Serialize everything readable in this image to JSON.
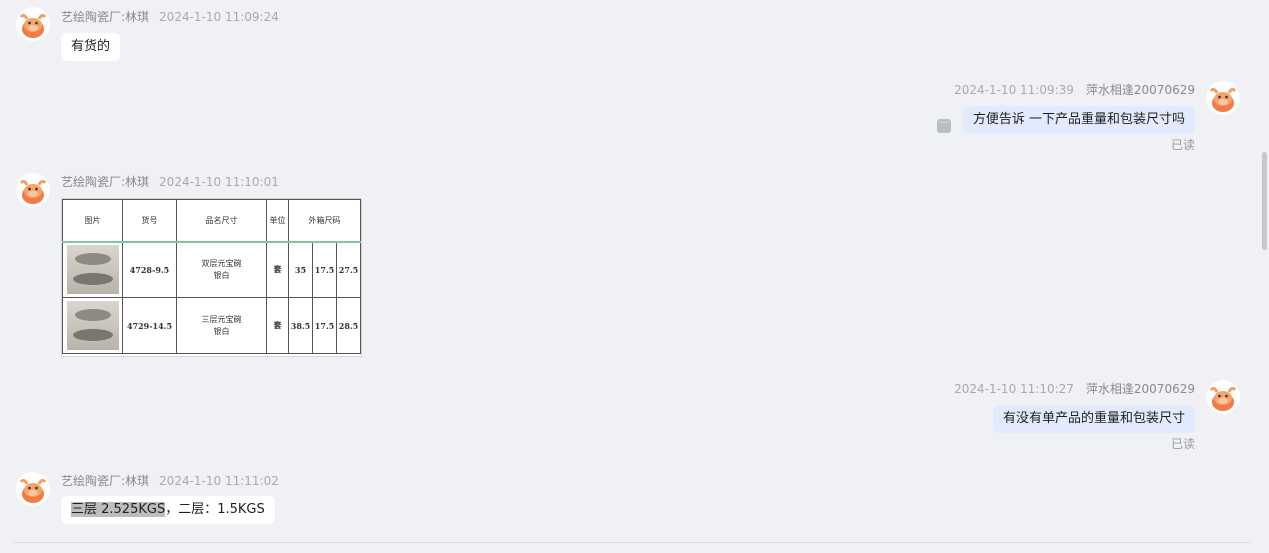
{
  "messages": [
    {
      "sender": "艺绘陶瓷厂:林琪",
      "time": "2024-1-10 11:09:24",
      "text": "有货的"
    },
    {
      "sender": "萍水相逢20070629",
      "time": "2024-1-10 11:09:39",
      "text": "方便告诉 一下产品重量和包装尺寸吗",
      "status": "已读"
    },
    {
      "sender": "艺绘陶瓷厂:林琪",
      "time": "2024-1-10 11:10:01",
      "table": {
        "headers": [
          "图片",
          "货号",
          "品名尺寸",
          "单位",
          "外箱尺码"
        ],
        "rows": [
          {
            "code": "4728-9.5",
            "name_line1": "双层元宝碗",
            "name_line2": "银白",
            "unit": "套",
            "dims": [
              "35",
              "17.5",
              "27.5"
            ]
          },
          {
            "code": "4729-14.5",
            "name_line1": "三层元宝碗",
            "name_line2": "银白",
            "unit": "套",
            "dims": [
              "38.5",
              "17.5",
              "28.5"
            ]
          }
        ]
      }
    },
    {
      "sender": "萍水相逢20070629",
      "time": "2024-1-10 11:10:27",
      "text": "有没有单产品的重量和包装尺寸",
      "status": "已读"
    },
    {
      "sender": "艺绘陶瓷厂:林琪",
      "time": "2024-1-10 11:11:02",
      "text_highlight": "三层 2.525KGS",
      "text_rest": "，二层：1.5KGS"
    }
  ],
  "more_icon_glyph": "···",
  "avatar_icon": "cartoon-cow-icon",
  "colors": {
    "bg": "#f0f1f5",
    "bubble_left": "#ffffff",
    "bubble_right": "#e2ebfd",
    "avatar": "#f07b46"
  }
}
